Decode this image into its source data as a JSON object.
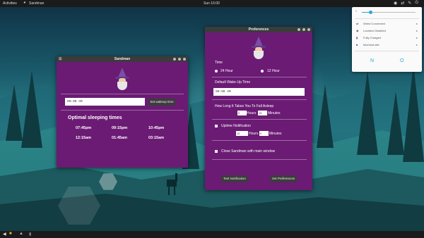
{
  "topbar": {
    "activities": "Activities",
    "app_name": "Sandman",
    "clock": "Sun 16:00"
  },
  "sandman": {
    "title": "Sandman",
    "time_input": "09:00 AM",
    "set_button": "Set wakeup time",
    "heading": "Optimal sleeping times",
    "times": [
      "07:45pm",
      "09:15pm",
      "10:45pm",
      "12:15am",
      "01:45am",
      "03:15am"
    ]
  },
  "prefs": {
    "title": "Preferences",
    "time_label": "Time",
    "h24": "24 Hour",
    "h12": "12 Hour",
    "default_wake_label": "Default Wake-Up Time",
    "default_wake_value": "09:00 AM",
    "fall_asleep_label": "How Long It Takes You To Fall Asleep",
    "fa_hours_value": "0",
    "hours_label": "Hours",
    "fa_minutes_value": "15",
    "minutes_label": "Minutes",
    "uptime_label": "Uptime Notification",
    "up_hours_value": "12",
    "up_minutes_value": "0",
    "close_label": "Close Sandman with main window",
    "test_button": "Test Notification",
    "set_button": "Set Preferences"
  },
  "sysmenu": {
    "items": [
      {
        "label": "Wired Connected",
        "icon": "network-icon"
      },
      {
        "label": "Location Disabled",
        "icon": "location-icon"
      },
      {
        "label": "Fully Charged",
        "icon": "battery-icon"
      },
      {
        "label": "bluehost-site",
        "icon": "user-icon"
      }
    ],
    "bottom_left": "N",
    "bottom_right": "O"
  },
  "colors": {
    "window_bg": "#6b1b74",
    "accent": "#2aa6d6"
  }
}
